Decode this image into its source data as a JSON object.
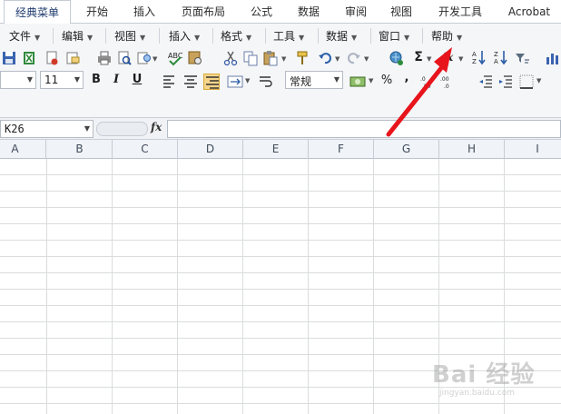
{
  "tabs": {
    "items": [
      {
        "label": "经典菜单",
        "active": true
      },
      {
        "label": "开始"
      },
      {
        "label": "插入"
      },
      {
        "label": "页面布局"
      },
      {
        "label": "公式"
      },
      {
        "label": "数据"
      },
      {
        "label": "审阅"
      },
      {
        "label": "视图"
      },
      {
        "label": "开发工具"
      },
      {
        "label": "Acrobat"
      }
    ]
  },
  "classic_menu": {
    "items": [
      {
        "label": "文件"
      },
      {
        "label": "编辑"
      },
      {
        "label": "视图"
      },
      {
        "label": "插入"
      },
      {
        "label": "格式"
      },
      {
        "label": "工具"
      },
      {
        "label": "数据"
      },
      {
        "label": "窗口"
      },
      {
        "label": "帮助"
      }
    ]
  },
  "format_toolbar": {
    "font_size": "11",
    "bold": "B",
    "italic": "I",
    "underline": "U",
    "number_format": "常规",
    "percent": "%",
    "comma": ","
  },
  "formula_bar": {
    "name_box": "K26",
    "fx_label": "fx",
    "formula": ""
  },
  "grid": {
    "columns": [
      "A",
      "B",
      "C",
      "D",
      "E",
      "F",
      "G",
      "H",
      "I"
    ]
  },
  "watermark": {
    "logo": "Bai 经验",
    "url": "jingyan.baidu.com"
  },
  "colors": {
    "accent": "#1e3b6e",
    "arrow": "#e8141c",
    "gridline": "#dadcdd",
    "header_bg": "#f0f3f7"
  },
  "icons": [
    "save-icon",
    "excel-icon",
    "permission-icon",
    "email-icon",
    "print-icon",
    "print-preview-icon",
    "research-icon",
    "spell-check-icon",
    "cut-icon",
    "copy-icon",
    "paste-icon",
    "format-painter-icon",
    "undo-icon",
    "redo-icon",
    "hyperlink-icon",
    "autosum-icon",
    "insert-function-icon",
    "sort-ascending-icon",
    "sort-descending-icon",
    "filter-icon",
    "chart-icon"
  ]
}
